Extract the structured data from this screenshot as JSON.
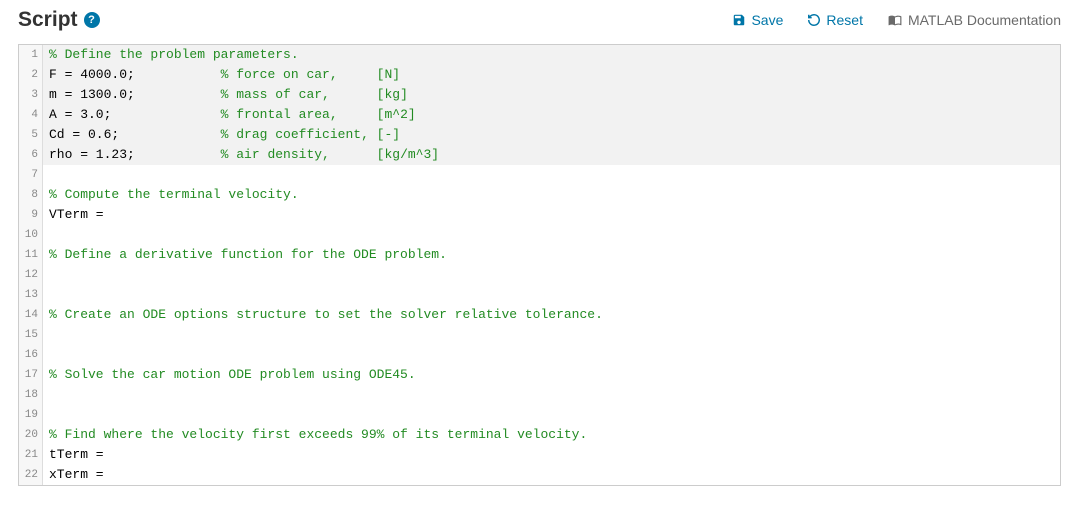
{
  "header": {
    "title": "Script",
    "help_glyph": "?",
    "save_label": "Save",
    "reset_label": "Reset",
    "doc_label": "MATLAB Documentation"
  },
  "code_lines": [
    {
      "n": 1,
      "hl": true,
      "segs": [
        {
          "t": "comment",
          "v": "% Define the problem parameters."
        }
      ]
    },
    {
      "n": 2,
      "hl": true,
      "segs": [
        {
          "t": "plain",
          "v": "F = 4000.0;           "
        },
        {
          "t": "comment",
          "v": "% force on car,     [N]"
        }
      ]
    },
    {
      "n": 3,
      "hl": true,
      "segs": [
        {
          "t": "plain",
          "v": "m = 1300.0;           "
        },
        {
          "t": "comment",
          "v": "% mass of car,      [kg]"
        }
      ]
    },
    {
      "n": 4,
      "hl": true,
      "segs": [
        {
          "t": "plain",
          "v": "A = 3.0;              "
        },
        {
          "t": "comment",
          "v": "% frontal area,     [m^2]"
        }
      ]
    },
    {
      "n": 5,
      "hl": true,
      "segs": [
        {
          "t": "plain",
          "v": "Cd = 0.6;             "
        },
        {
          "t": "comment",
          "v": "% drag coefficient, [-]"
        }
      ]
    },
    {
      "n": 6,
      "hl": true,
      "segs": [
        {
          "t": "plain",
          "v": "rho = 1.23;           "
        },
        {
          "t": "comment",
          "v": "% air density,      [kg/m^3]"
        }
      ]
    },
    {
      "n": 7,
      "hl": false,
      "segs": []
    },
    {
      "n": 8,
      "hl": false,
      "segs": [
        {
          "t": "comment",
          "v": "% Compute the terminal velocity."
        }
      ]
    },
    {
      "n": 9,
      "hl": false,
      "segs": [
        {
          "t": "plain",
          "v": "VTerm = "
        }
      ]
    },
    {
      "n": 10,
      "hl": false,
      "segs": []
    },
    {
      "n": 11,
      "hl": false,
      "segs": [
        {
          "t": "comment",
          "v": "% Define a derivative function for the ODE problem."
        }
      ]
    },
    {
      "n": 12,
      "hl": false,
      "segs": []
    },
    {
      "n": 13,
      "hl": false,
      "segs": []
    },
    {
      "n": 14,
      "hl": false,
      "segs": [
        {
          "t": "comment",
          "v": "% Create an ODE options structure to set the solver relative tolerance."
        }
      ]
    },
    {
      "n": 15,
      "hl": false,
      "segs": []
    },
    {
      "n": 16,
      "hl": false,
      "segs": []
    },
    {
      "n": 17,
      "hl": false,
      "segs": [
        {
          "t": "comment",
          "v": "% Solve the car motion ODE problem using ODE45."
        }
      ]
    },
    {
      "n": 18,
      "hl": false,
      "segs": []
    },
    {
      "n": 19,
      "hl": false,
      "segs": []
    },
    {
      "n": 20,
      "hl": false,
      "segs": [
        {
          "t": "comment",
          "v": "% Find where the velocity first exceeds 99% of its terminal velocity."
        }
      ]
    },
    {
      "n": 21,
      "hl": false,
      "segs": [
        {
          "t": "plain",
          "v": "tTerm = "
        }
      ]
    },
    {
      "n": 22,
      "hl": false,
      "segs": [
        {
          "t": "plain",
          "v": "xTerm = "
        }
      ]
    }
  ]
}
